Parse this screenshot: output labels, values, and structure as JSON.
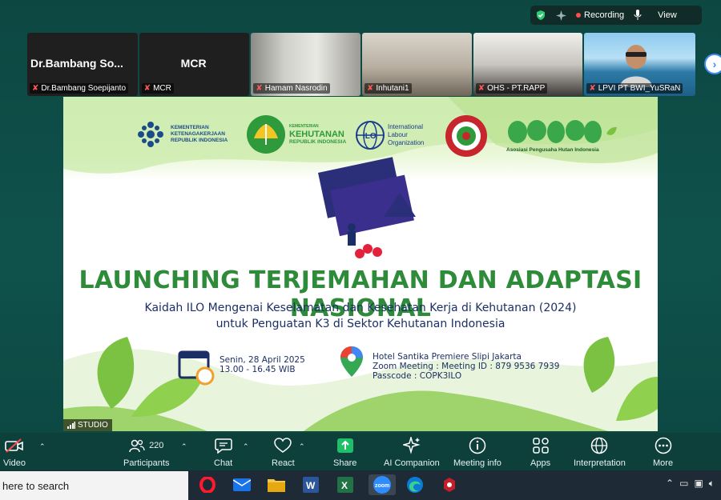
{
  "topbar": {
    "recording_label": "Recording",
    "view_label": "View",
    "icons": [
      "shield-check-icon",
      "sparkle-icon",
      "microphone-icon"
    ]
  },
  "thumbnails": [
    {
      "big_name": "Dr.Bambang  So...",
      "tag": "Dr.Bambang Soepijanto",
      "muted": true
    },
    {
      "big_name": "MCR",
      "tag": "MCR",
      "muted": true
    },
    {
      "tag": "Hamam Nasrodin",
      "muted": true
    },
    {
      "tag": "Inhutani1",
      "muted": true
    },
    {
      "tag": "OHS - PT.RAPP",
      "muted": true
    },
    {
      "tag": "LPVI PT BWI_YuSRaN",
      "muted": true
    }
  ],
  "slide": {
    "logos": [
      {
        "line1": "KEMENTERIAN",
        "line2": "KETENAGAKERJAAN",
        "line3": "REPUBLIK INDONESIA"
      },
      {
        "line1": "KEMENTERIAN",
        "line2": "KEHUTANAN",
        "line3": "REPUBLIK INDONESIA"
      },
      {
        "line1": "International",
        "line2": "Labour",
        "line3": "Organization"
      },
      {
        "line1": "Asosiasi Pengusaha Hutan Indonesia"
      }
    ],
    "title": "LAUNCHING TERJEMAHAN DAN ADAPTASI NASIONAL",
    "subtitle1": "Kaidah ILO Mengenai Keselamatan dan Kesehatan Kerja di Kehutanan (2024)",
    "subtitle2": "untuk Penguatan K3 di Sektor Kehutanan Indonesia",
    "date": "Senin, 28 April 2025",
    "time": "13.00 - 16.45 WIB",
    "venue": "Hotel Santika Premiere Slipi Jakarta",
    "zoom": "Zoom Meeting : Meeting ID : 879 9536 7939",
    "passcode": "Passcode : COPK3ILO",
    "studio_label": "STUDIO",
    "colors": {
      "title_green": "#2e8b3a",
      "navy": "#1b2f66",
      "leaf": "#7cc242"
    }
  },
  "toolbar": {
    "video": "Video",
    "participants": "Participants",
    "participants_count": "220",
    "chat": "Chat",
    "react": "React",
    "share": "Share",
    "ai": "AI Companion",
    "meeting_info": "Meeting info",
    "apps": "Apps",
    "interpretation": "Interpretation",
    "more": "More"
  },
  "taskbar": {
    "search_placeholder": "here to search",
    "apps": [
      "opera-icon",
      "mail-icon",
      "folder-icon",
      "word-icon",
      "excel-icon",
      "zoom-icon",
      "edge-icon",
      "game-icon"
    ]
  }
}
